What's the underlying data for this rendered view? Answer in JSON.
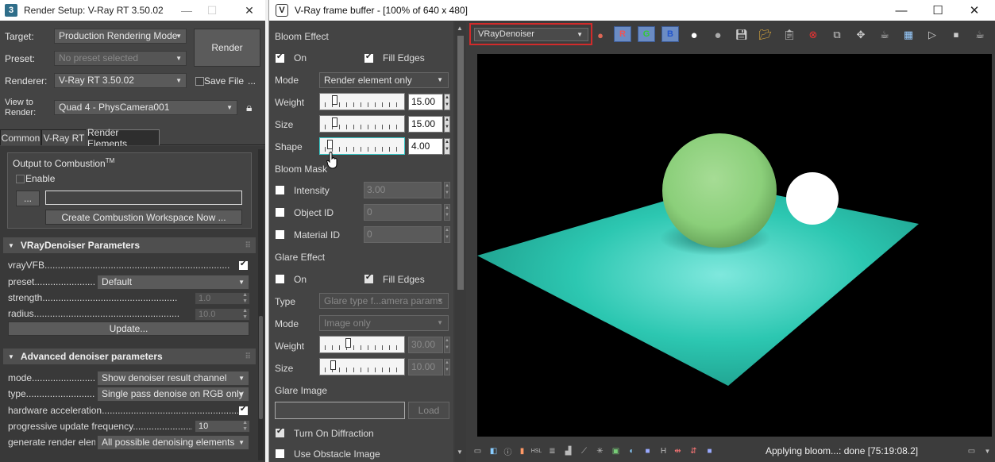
{
  "render_setup": {
    "title": "Render Setup: V-Ray RT 3.50.02",
    "app_icon": "3",
    "target_label": "Target:",
    "target_value": "Production Rendering Mode",
    "preset_label": "Preset:",
    "preset_value": "No preset selected",
    "renderer_label": "Renderer:",
    "renderer_value": "V-Ray RT 3.50.02",
    "save_file_label": "Save File",
    "ellipsis": "...",
    "view_label_1": "View to",
    "view_label_2": "Render:",
    "view_value": "Quad 4 - PhysCamera001",
    "render_button": "Render",
    "tabs": [
      "Common",
      "V-Ray RT",
      "Render Elements"
    ],
    "combustion": {
      "title": "Output to Combustion",
      "tm": "TM",
      "enable_label": "Enable",
      "browse": "...",
      "create_button": "Create Combustion Workspace Now ..."
    },
    "denoiser": {
      "title": "VRayDenoiser Parameters",
      "vrayvfb": "vrayVFB......................................................................",
      "preset": "preset.......................",
      "preset_value": "Default",
      "strength": "strength...................................................",
      "strength_value": "1.0",
      "radius": "radius.......................................................",
      "radius_value": "10.0",
      "update_button": "Update..."
    },
    "advanced": {
      "title": "Advanced denoiser parameters",
      "mode": "mode..........................",
      "mode_value": "Show denoiser result channel",
      "type": "type..........................",
      "type_value": "Single pass denoise on RGB only",
      "hw": "hardware acceleration........................................................",
      "progressive": "progressive update frequency........................",
      "progressive_value": "10",
      "generate": "generate render eleme",
      "generate_value": "All possible denoising elements"
    }
  },
  "vfb": {
    "title": "V-Ray frame buffer - [100% of 640 x 480]",
    "channel": "VRayDenoiser",
    "rgb_buttons": [
      "R",
      "G",
      "B"
    ],
    "bloom": {
      "title": "Bloom Effect",
      "on": "On",
      "fill_edges": "Fill Edges",
      "mode_label": "Mode",
      "mode_value": "Render element only",
      "weight_label": "Weight",
      "weight_value": "15.00",
      "weight": 0.13,
      "size_label": "Size",
      "size_value": "15.00",
      "size": 0.13,
      "shape_label": "Shape",
      "shape_value": "4.00",
      "shape": 0.06
    },
    "mask": {
      "title": "Bloom Mask",
      "intensity": "Intensity",
      "intensity_value": "3.00",
      "object_id": "Object ID",
      "object_id_value": "0",
      "material_id": "Material ID",
      "material_id_value": "0"
    },
    "glare": {
      "title": "Glare Effect",
      "on": "On",
      "fill_edges": "Fill Edges",
      "type_label": "Type",
      "type_value": "Glare type f...amera params",
      "mode_label": "Mode",
      "mode_value": "Image only",
      "weight_label": "Weight",
      "weight_value": "30.00",
      "weight": 0.3,
      "size_label": "Size",
      "size_value": "10.00",
      "size": 0.1
    },
    "glare_image": {
      "title": "Glare Image",
      "load_button": "Load",
      "diffraction": "Turn On Diffraction",
      "obstacle": "Use Obstacle Image"
    },
    "status": "Applying bloom...: done [75:19:08.2]",
    "colors": {
      "accent_red": "#d12b2b",
      "plane": "#2fcab4",
      "sphere": "#8fd17f"
    }
  }
}
